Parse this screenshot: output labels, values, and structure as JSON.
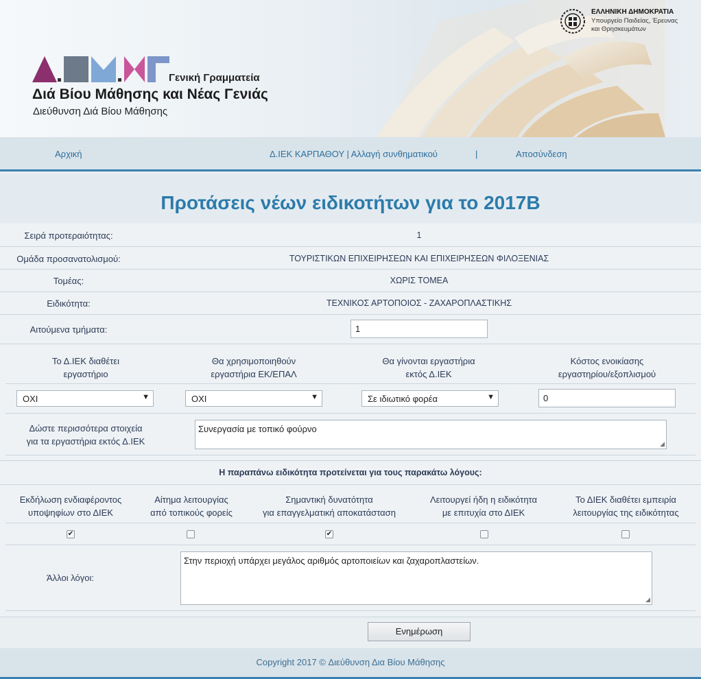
{
  "header": {
    "logo_text": "Δ.ΒΜ.ΝΓ",
    "secretariat": "Γενική Γραμματεία",
    "org_line1": "Διά Βίου Μάθησης και Νέας Γενιάς",
    "org_line2": "Διεύθυνση Διά Βίου Μάθησης",
    "gov_title": "ΕΛΛΗΝΙΚΗ ΔΗΜΟΚΡΑΤΙΑ",
    "gov_line2": "Υπουργείο Παιδείας, Έρευνας",
    "gov_line3": "και Θρησκευμάτων",
    "logo_colors": [
      "#8b2f6d",
      "#6d7a8a",
      "#7fa8d6",
      "#c9569a",
      "#7d95c8"
    ]
  },
  "nav": {
    "home": "Αρχική",
    "account": "Δ.ΙΕΚ ΚΑΡΠΑΘΟΥ | Αλλαγή συνθηματικού",
    "separator": "|",
    "logout": "Αποσύνδεση"
  },
  "page_title": "Προτάσεις νέων ειδικοτήτων για το 2017Β",
  "info": {
    "priority_label": "Σειρά προτεραιότητας:",
    "priority_value": "1",
    "group_label": "Ομάδα προσανατολισμού:",
    "group_value": "ΤΟΥΡΙΣΤΙΚΩΝ ΕΠΙΧΕΙΡΗΣΕΩΝ ΚΑΙ ΕΠΙΧΕΙΡΗΣΕΩΝ ΦΙΛΟΞΕΝΙΑΣ",
    "sector_label": "Τομέας:",
    "sector_value": "ΧΩΡΙΣ ΤΟΜΕΑ",
    "specialty_label": "Ειδικότητα:",
    "specialty_value": "ΤΕΧΝΙΚΟΣ ΑΡΤΟΠΟΙΟΣ - ΖΑΧΑΡΟΠΛΑΣΤΙΚΗΣ",
    "classes_label": "Αιτούμενα τμήματα:",
    "classes_value": "1"
  },
  "labs": {
    "col1_line1": "Το Δ.ΙΕΚ διαθέτει",
    "col1_line2": "εργαστήριο",
    "col2_line1": "Θα χρησιμοποιηθούν",
    "col2_line2": "εργαστήρια ΕΚ/ΕΠΑΛ",
    "col3_line1": "Θα γίνονται εργαστήρια",
    "col3_line2": "εκτός Δ.ΙΕΚ",
    "col4_line1": "Κόστος ενοικίασης",
    "col4_line2": "εργαστηρίου/εξοπλισμού",
    "has_lab": "ΟΧΙ",
    "use_ek": "ΟΧΙ",
    "external": "Σε ιδιωτικό φορέα",
    "cost": "0",
    "more_label_line1": "Δώστε περισσότερα στοιχεία",
    "more_label_line2": "για τα εργαστήρια εκτός Δ.ΙΕΚ",
    "more_value": "Συνεργασία με τοπικό φούρνο"
  },
  "reasons": {
    "heading": "Η παραπάνω ειδικότητα προτείνεται για τους παρακάτω λόγους:",
    "r1_line1": "Εκδήλωση ενδιαφέροντος",
    "r1_line2": "υποψηφίων στο ΔΙΕΚ",
    "r2_line1": "Αίτημα λειτουργίας",
    "r2_line2": "από τοπικούς φορείς",
    "r3_line1": "Σημαντική δυνατότητα",
    "r3_line2": "για επαγγελματική αποκατάσταση",
    "r4_line1": "Λειτουργεί ήδη η ειδικότητα",
    "r4_line2": "με επιτυχία στο ΔΙΕΚ",
    "r5_line1": "Το ΔΙΕΚ διαθέτει εμπειρία",
    "r5_line2": "λειτουργίας της ειδικότητας",
    "checked": [
      true,
      false,
      true,
      false,
      false
    ],
    "check_mark": "✔",
    "other_label": "Άλλοι λόγοι:",
    "other_value": "Στην περιοχή υπάρχει μεγάλος αριθμός αρτοποιείων και ζαχαροπλαστείων."
  },
  "dropdown_arrow": "▼",
  "resize_grip": "◢",
  "update_button": "Ενημέρωση",
  "footer": "Copyright 2017 © Διεύθυνση Δια Βίου Μάθησης"
}
